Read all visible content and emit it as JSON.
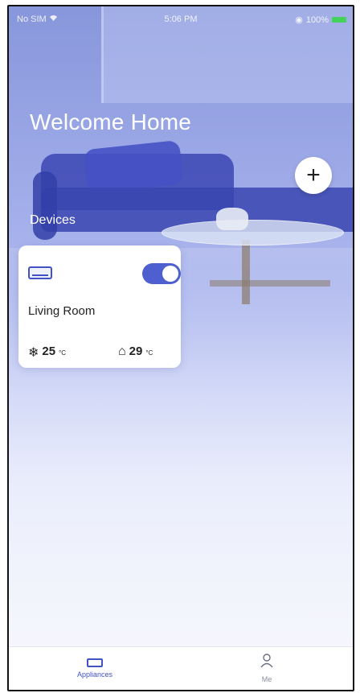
{
  "status_bar": {
    "carrier": "No SIM",
    "wifi_icon": "wifi-icon",
    "time": "5:06 PM",
    "battery": "100%",
    "battery_color": "#43d35a"
  },
  "header": {
    "title": "Welcome Home",
    "add_icon": "plus-icon"
  },
  "devices_section": {
    "label": "Devices"
  },
  "device_card": {
    "device_icon": "air-conditioner-icon",
    "power_on": true,
    "name": "Living Room",
    "set_temperature": "25",
    "set_unit": "°C",
    "set_icon": "snowflake-icon",
    "room_temperature": "29",
    "room_unit": "°C",
    "room_icon": "home-icon"
  },
  "tab_bar": {
    "tabs": [
      {
        "label": "Appliances",
        "icon": "appliance-icon",
        "active": true
      },
      {
        "label": "Me",
        "icon": "person-icon",
        "active": false
      }
    ]
  },
  "colors": {
    "accent": "#4352c4",
    "toggle_on": "#4e5fd0"
  }
}
